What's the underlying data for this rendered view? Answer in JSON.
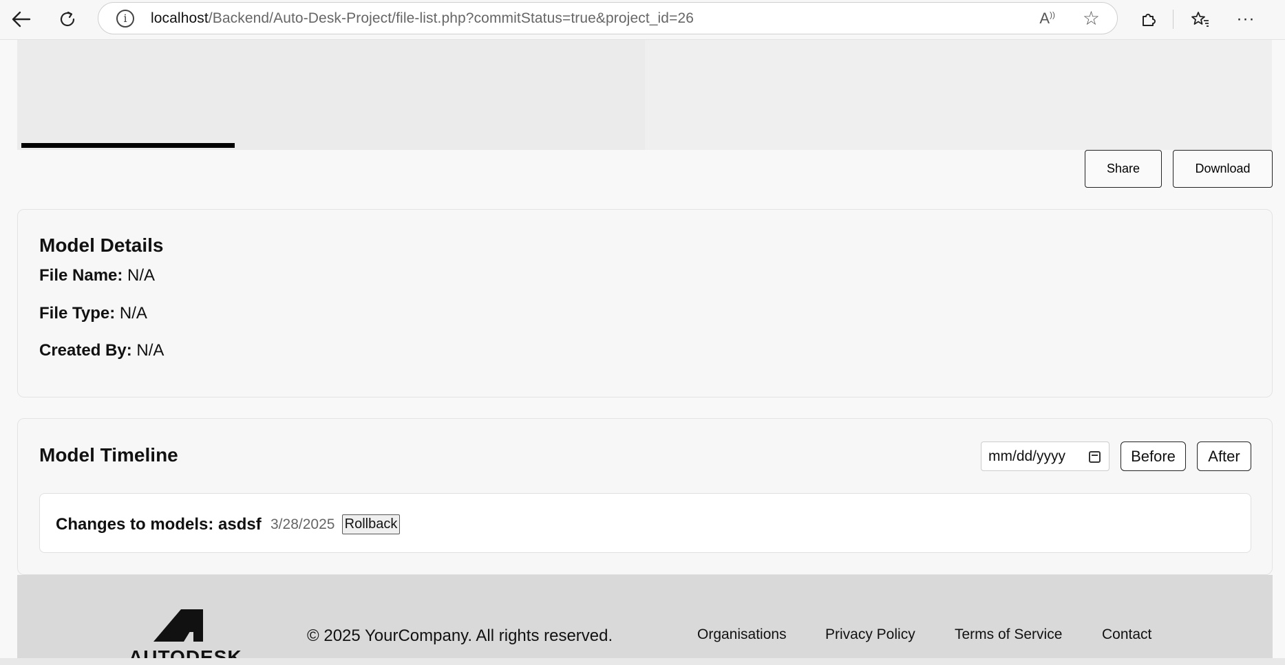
{
  "browser": {
    "url_host": "localhost",
    "url_path": "/Backend/Auto-Desk-Project/file-list.php?commitStatus=true&project_id=26",
    "icons": [
      "back-arrow-icon",
      "refresh-icon",
      "info-icon",
      "read-aloud-icon",
      "star-icon",
      "extensions-icon",
      "favorites-icon",
      "more-icon"
    ]
  },
  "viewer": {
    "progress_fraction": 0.17
  },
  "actions": {
    "share_label": "Share",
    "download_label": "Download"
  },
  "model_details": {
    "title": "Model Details",
    "fields": [
      {
        "label": "File Name:",
        "value": "N/A"
      },
      {
        "label": "File Type:",
        "value": "N/A"
      },
      {
        "label": "Created By:",
        "value": "N/A"
      }
    ]
  },
  "timeline": {
    "title": "Model Timeline",
    "date_placeholder": "mm/dd/yyyy",
    "before_label": "Before",
    "after_label": "After",
    "entries": [
      {
        "text": "Changes to models: asdsf",
        "date": "3/28/2025",
        "action": "Rollback"
      }
    ]
  },
  "footer": {
    "logo_text": "AUTODESK",
    "copyright": "© 2025 YourCompany. All rights reserved.",
    "links": [
      "Organisations",
      "Privacy Policy",
      "Terms of Service",
      "Contact"
    ]
  },
  "colors": {
    "footer_bg": "#d9d9d9",
    "page_bg": "#f8f8f8"
  }
}
